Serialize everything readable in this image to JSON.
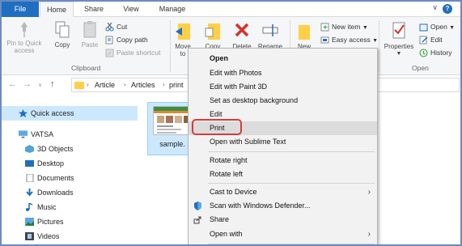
{
  "ribbon_tabs": [
    "File",
    "Home",
    "Share",
    "View",
    "Manage"
  ],
  "clipboard": {
    "pin_to_quick_access": "Pin to Quick access",
    "copy": "Copy",
    "paste": "Paste",
    "cut": "Cut",
    "copy_path": "Copy path",
    "paste_shortcut": "Paste shortcut",
    "group_label": "Clipboard"
  },
  "organize": {
    "move_to": "Move to",
    "copy_to": "Copy to",
    "delete": "Delete",
    "rename": "Rename"
  },
  "new": {
    "new_folder": "New folder",
    "new_item": "New item",
    "easy_access": "Easy access"
  },
  "open": {
    "properties": "Properties",
    "open": "Open",
    "edit": "Edit",
    "history": "History",
    "group_label": "Open"
  },
  "address": {
    "crumbs": [
      "Article",
      "Articles",
      "print"
    ]
  },
  "nav_pane": {
    "items": [
      "Quick access",
      "VATSA",
      "3D Objects",
      "Desktop",
      "Documents",
      "Downloads",
      "Music",
      "Pictures",
      "Videos"
    ]
  },
  "file": {
    "name": "sample."
  },
  "context_menu": {
    "items": [
      "Open",
      "Edit with Photos",
      "Edit with Paint 3D",
      "Set as desktop background",
      "Edit",
      "Print",
      "Open with Sublime Text",
      "Rotate right",
      "Rotate left",
      "Cast to Device",
      "Scan with Windows Defender...",
      "Share",
      "Open with"
    ]
  },
  "colors": {
    "file_tab": "#1f6fc1",
    "selection": "#cce8ff",
    "highlight_ring": "#d63c3c",
    "delete_x": "#d9302b"
  }
}
